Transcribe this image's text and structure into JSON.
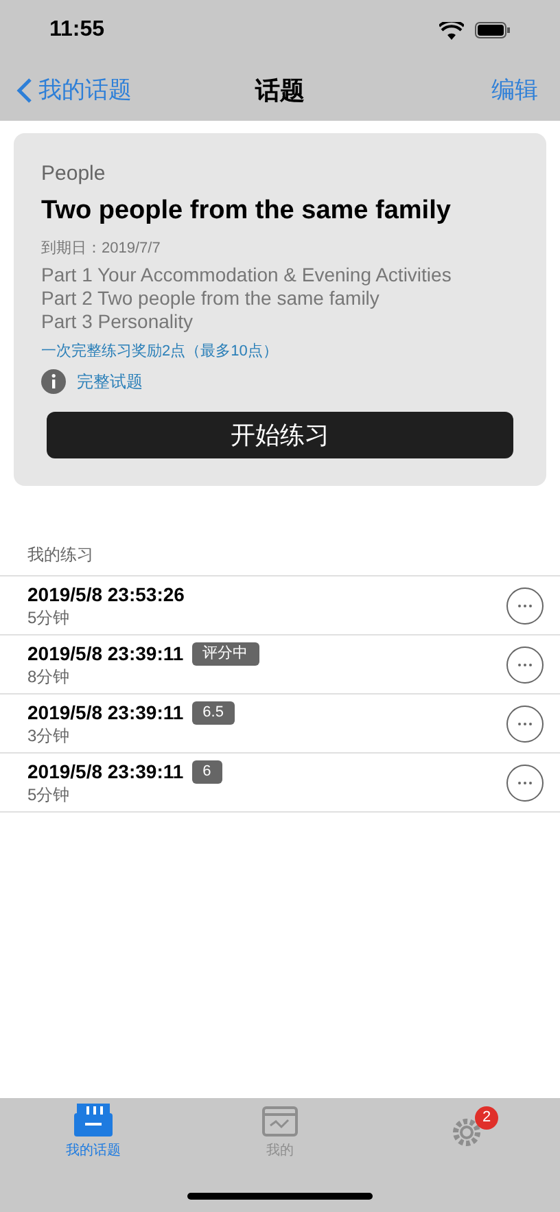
{
  "status_bar": {
    "time": "11:55"
  },
  "nav": {
    "back": "我的话题",
    "title": "话题",
    "action": "编辑"
  },
  "topic": {
    "category": "People",
    "title": "Two people from the same family",
    "due": "到期日：2019/7/7",
    "parts": [
      "Part 1 Your Accommodation & Evening Activities",
      "Part 2 Two people from the same family",
      "Part 3 Personality"
    ],
    "reward": "一次完整练习奖励2点（最多10点）",
    "full_link": "完整试题",
    "start_button": "开始练习"
  },
  "practice": {
    "header": "我的练习",
    "rows": [
      {
        "time": "2019/5/8 23:53:26",
        "duration": "5分钟"
      },
      {
        "time": "2019/5/8 23:39:11",
        "badge": "评分中",
        "duration": "8分钟"
      },
      {
        "time": "2019/5/8 23:39:11",
        "badge": "6.5",
        "duration": "3分钟"
      },
      {
        "time": "2019/5/8 23:39:11",
        "badge": "6",
        "duration": "5分钟"
      }
    ]
  },
  "tab_bar": [
    {
      "kind": "topics",
      "label": "我的话题",
      "selected": true
    },
    {
      "kind": "calendar",
      "label": "我的",
      "selected": false
    },
    {
      "kind": "settings",
      "badge": "2",
      "selected": false
    }
  ]
}
